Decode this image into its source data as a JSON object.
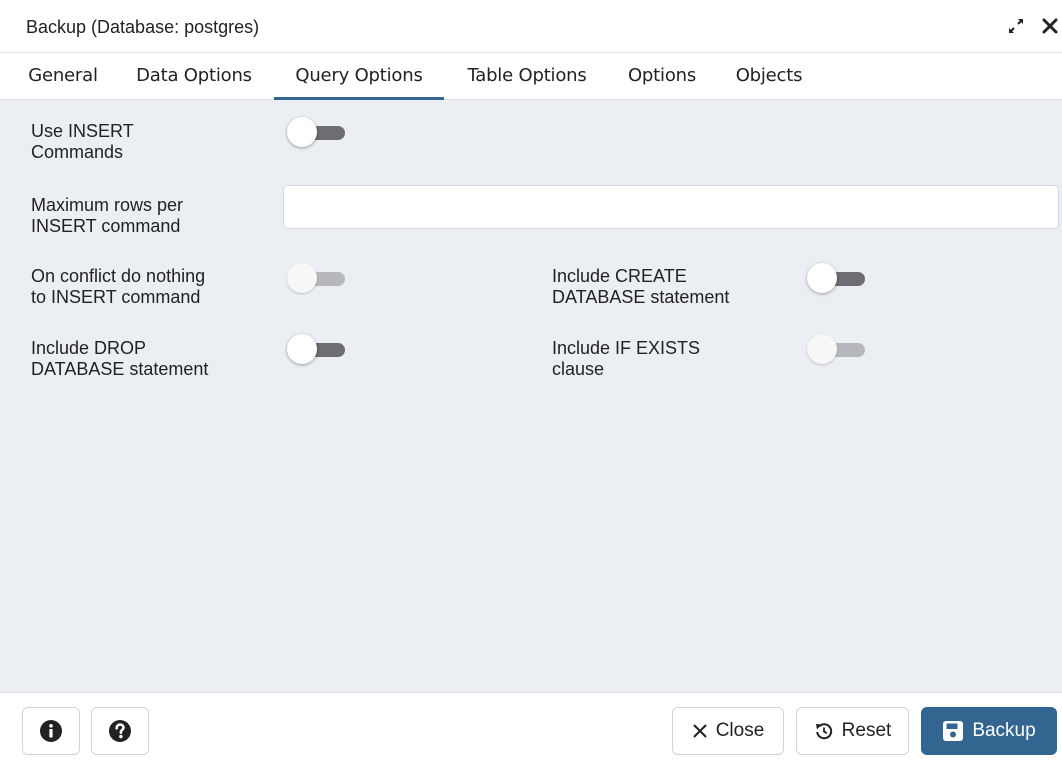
{
  "dialog": {
    "title": "Backup (Database: postgres)"
  },
  "tabs": [
    {
      "label": "General"
    },
    {
      "label": "Data Options"
    },
    {
      "label": "Query Options",
      "active": true
    },
    {
      "label": "Table Options"
    },
    {
      "label": "Options"
    },
    {
      "label": "Objects"
    }
  ],
  "form": {
    "use_insert": {
      "label_line1": "Use INSERT",
      "label_line2": "Commands",
      "checked": false,
      "enabled": true
    },
    "max_rows": {
      "label_line1": "Maximum rows per",
      "label_line2": "INSERT command",
      "value": "",
      "placeholder": ""
    },
    "on_conflict": {
      "label_line1": "On conflict do nothing",
      "label_line2": "to INSERT command",
      "checked": false,
      "enabled": false
    },
    "include_create": {
      "label_line1": "Include CREATE",
      "label_line2": "DATABASE statement",
      "checked": false,
      "enabled": true
    },
    "include_drop": {
      "label_line1": "Include DROP",
      "label_line2": "DATABASE statement",
      "checked": false,
      "enabled": true
    },
    "if_exists": {
      "label_line1": "Include IF EXISTS",
      "label_line2": "clause",
      "checked": false,
      "enabled": false
    }
  },
  "footer": {
    "close_label": "Close",
    "reset_label": "Reset",
    "backup_label": "Backup"
  },
  "colors": {
    "accent": "#326690",
    "panel_bg": "#ebeef3",
    "toggle_off": "#6e6e72",
    "toggle_disabled": "#b7b8bd"
  },
  "icons": [
    "expand-icon",
    "close-icon",
    "info-icon",
    "help-icon",
    "x-icon",
    "reset-icon",
    "save-icon"
  ]
}
